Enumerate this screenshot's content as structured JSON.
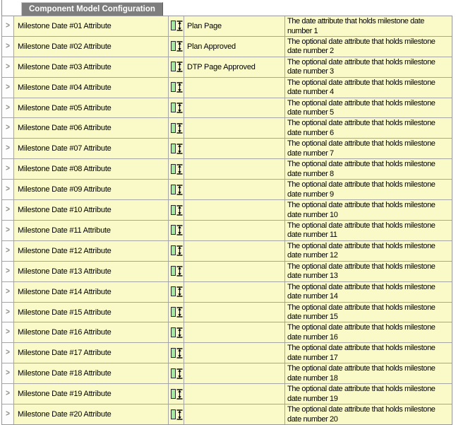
{
  "tab": {
    "title": "Component Model Configuration"
  },
  "icons": {
    "expand_chevron": ">",
    "attribute_type_icon": "vertical-resize-icon"
  },
  "colors": {
    "row_background": "#FAFAC9",
    "grid_line": "#A5A5A5",
    "tab_background": "#7E7E7E",
    "tab_text": "#FFFFFF",
    "icon_green": "#A3EC9E"
  },
  "table": {
    "rows": [
      {
        "label": "Milestone Date #01 Attribute",
        "value": "Plan Page",
        "description": "The date attribute that holds milestone date number 1"
      },
      {
        "label": "Milestone Date #02 Attribute",
        "value": "Plan Approved",
        "description": "The optional date attribute that holds milestone date number 2"
      },
      {
        "label": "Milestone Date #03 Attribute",
        "value": "DTP Page Approved",
        "description": "The optional date attribute that holds milestone date number 3"
      },
      {
        "label": "Milestone Date #04 Attribute",
        "value": "",
        "description": "The optional date attribute that holds milestone date number 4"
      },
      {
        "label": "Milestone Date #05 Attribute",
        "value": "",
        "description": "The optional date attribute that holds milestone date number 5"
      },
      {
        "label": "Milestone Date #06 Attribute",
        "value": "",
        "description": "The optional date attribute that holds milestone date number 6"
      },
      {
        "label": "Milestone Date #07 Attribute",
        "value": "",
        "description": "The optional date attribute that holds milestone date number 7"
      },
      {
        "label": "Milestone Date #08 Attribute",
        "value": "",
        "description": "The optional date attribute that holds milestone date number 8"
      },
      {
        "label": "Milestone Date #09 Attribute",
        "value": "",
        "description": "The optional date attribute that holds milestone date number 9"
      },
      {
        "label": "Milestone Date #10 Attribute",
        "value": "",
        "description": "The optional date attribute that holds milestone date number 10"
      },
      {
        "label": "Milestone Date #11 Attribute",
        "value": "",
        "description": "The optional date attribute that holds milestone date number 11"
      },
      {
        "label": "Milestone Date #12 Attribute",
        "value": "",
        "description": "The optional date attribute that holds milestone date number 12"
      },
      {
        "label": "Milestone Date #13 Attribute",
        "value": "",
        "description": "The optional date attribute that holds milestone date number 13"
      },
      {
        "label": "Milestone Date #14 Attribute",
        "value": "",
        "description": "The optional date attribute that holds milestone date number 14"
      },
      {
        "label": "Milestone Date #15 Attribute",
        "value": "",
        "description": "The optional date attribute that holds milestone date number 15"
      },
      {
        "label": "Milestone Date #16 Attribute",
        "value": "",
        "description": "The optional date attribute that holds milestone date number 16"
      },
      {
        "label": "Milestone Date #17 Attribute",
        "value": "",
        "description": "The optional date attribute that holds milestone date number 17"
      },
      {
        "label": "Milestone Date #18 Attribute",
        "value": "",
        "description": "The optional date attribute that holds milestone date number 18"
      },
      {
        "label": "Milestone Date #19 Attribute",
        "value": "",
        "description": "The optional date attribute that holds milestone date number 19"
      },
      {
        "label": "Milestone Date #20 Attribute",
        "value": "",
        "description": "The optional date attribute that holds milestone date number 20"
      }
    ]
  }
}
